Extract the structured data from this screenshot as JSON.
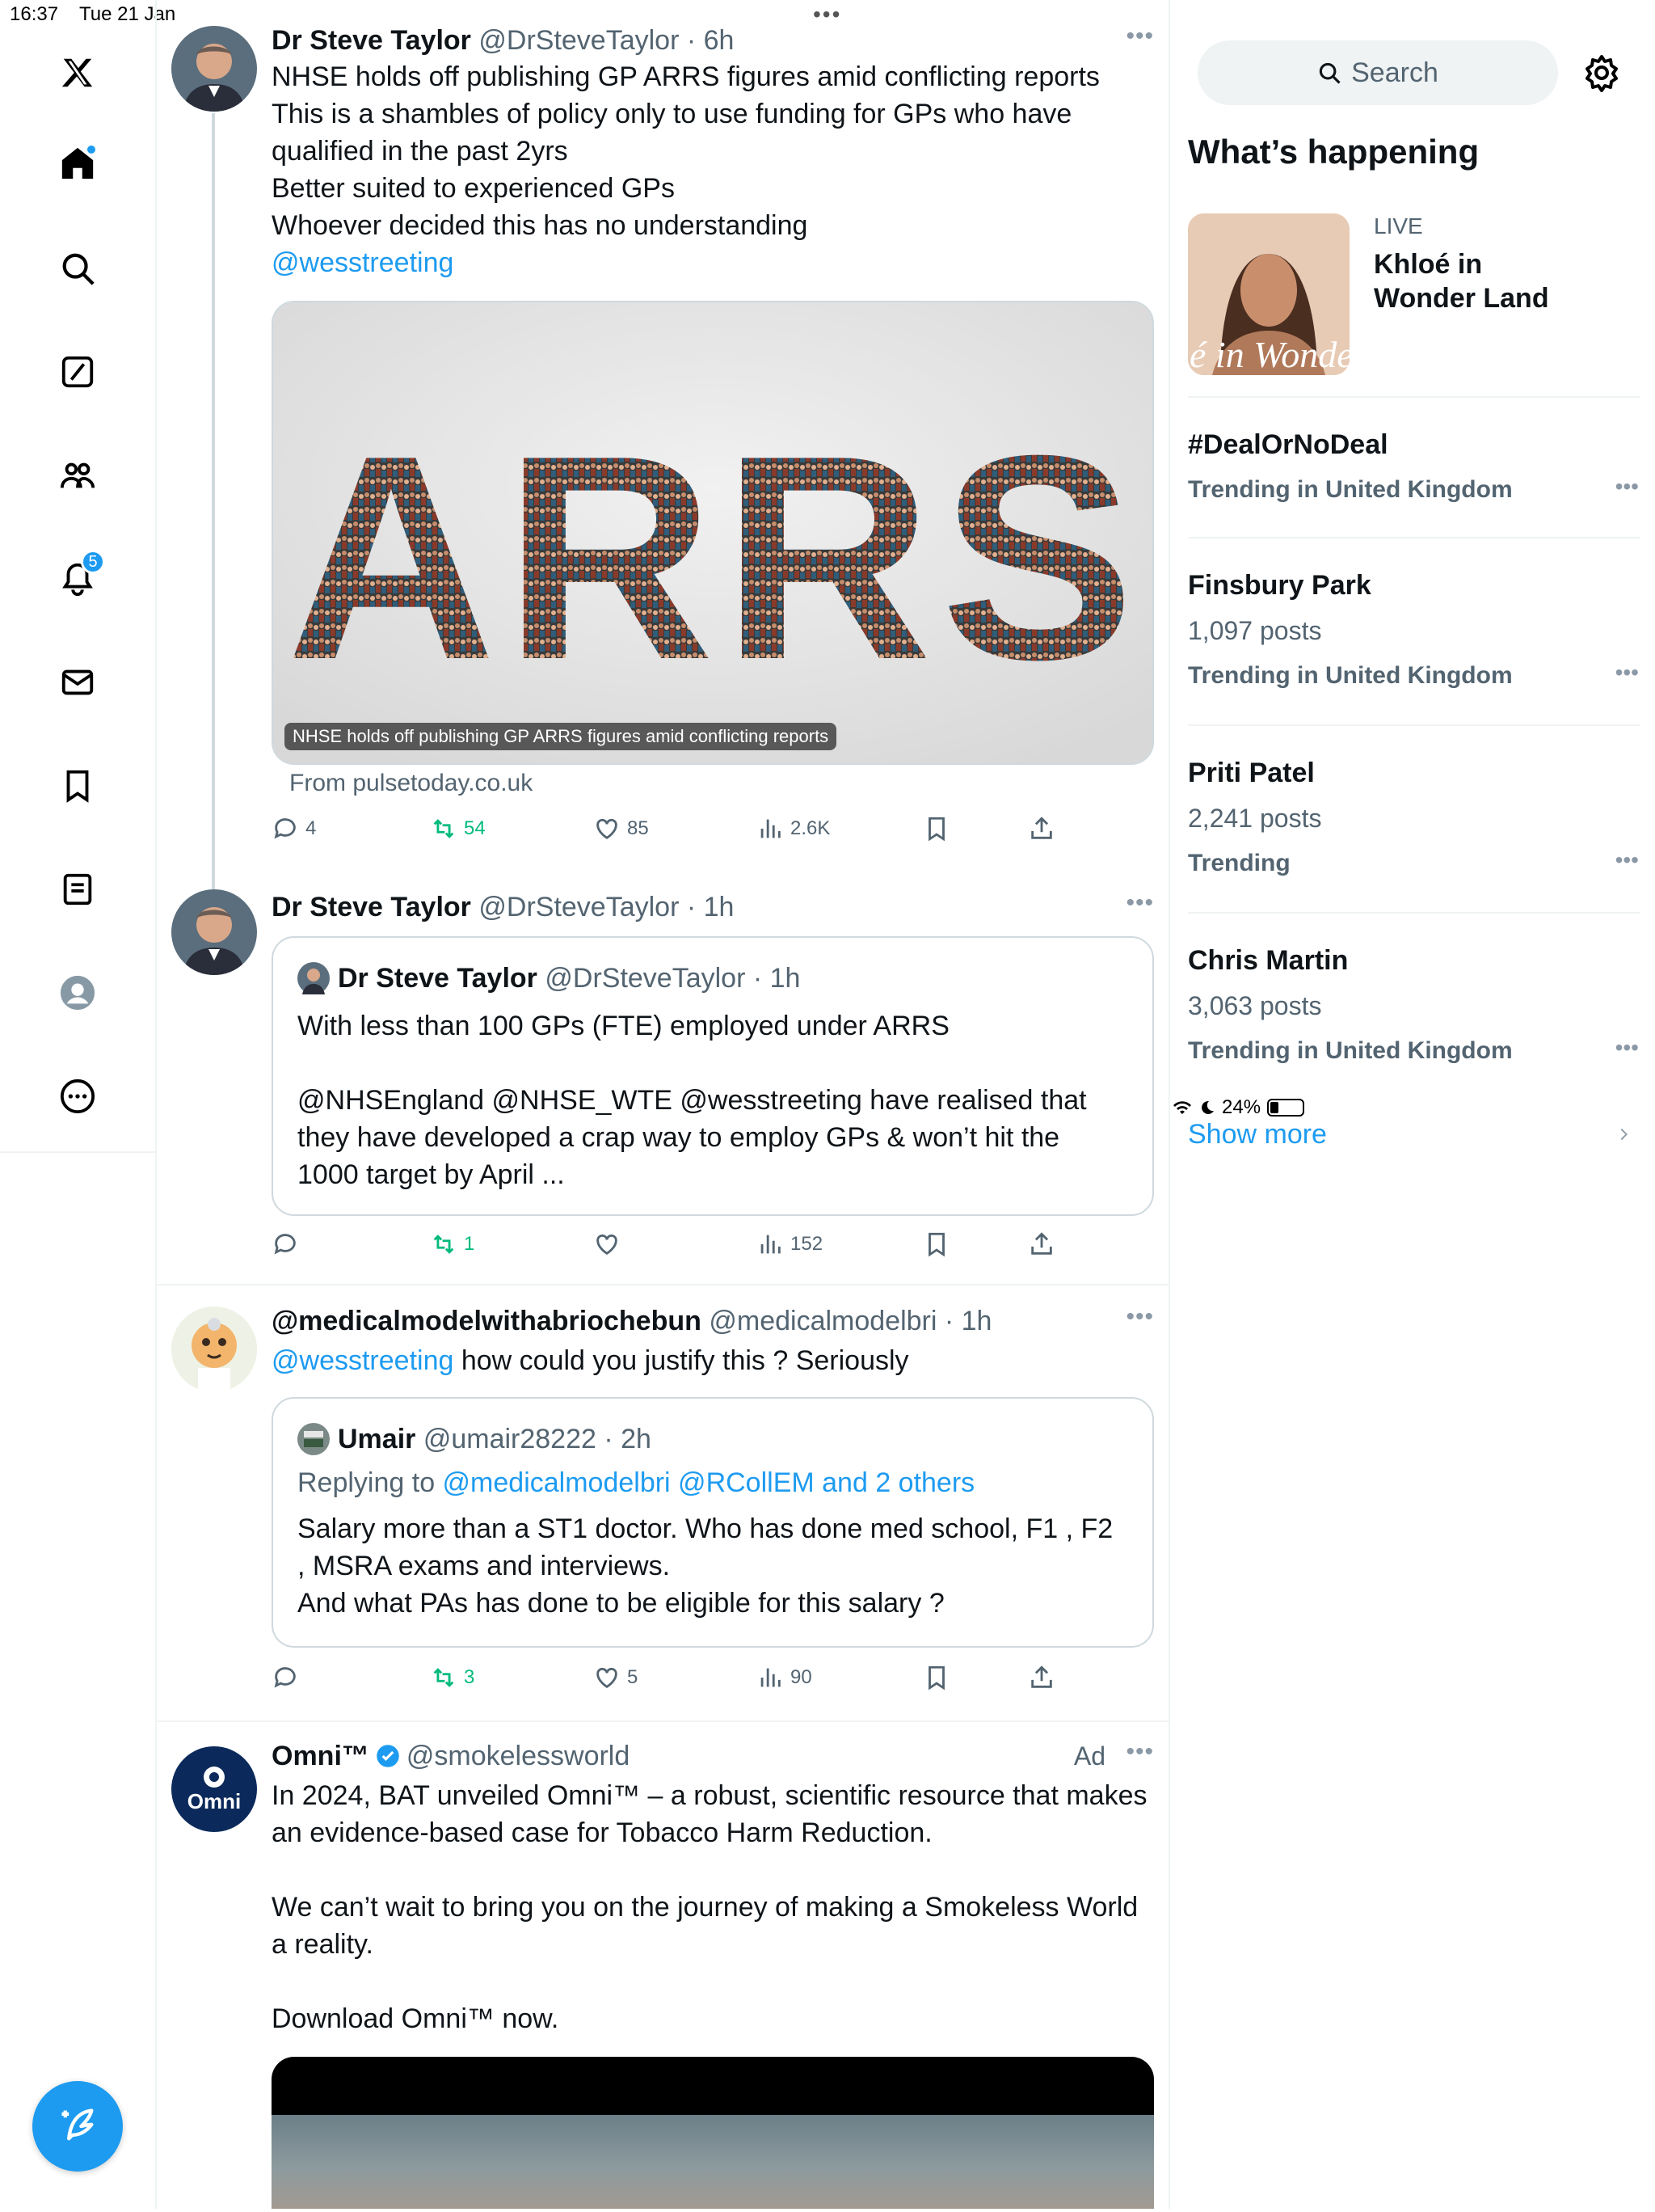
{
  "status": {
    "time": "16:37",
    "date": "Tue 21 Jan",
    "battery": "24%"
  },
  "nav": {
    "notif_count": "5"
  },
  "tweets": [
    {
      "name": "Dr Steve Taylor",
      "meta": "@DrSteveTaylor · 6h",
      "lines": [
        "NHSE holds off publishing GP ARRS figures amid conflicting reports",
        "This is a shambles of policy only to use funding for GPs who have qualified in the past 2yrs",
        "Better suited to experienced GPs",
        "Whoever decided this has no understanding"
      ],
      "mention": "@wesstreeting",
      "card_caption": "NHSE holds off publishing GP ARRS figures amid conflicting reports",
      "card_source": "From pulsetoday.co.uk",
      "card_image_text": "ARRS",
      "replies": "4",
      "retweets": "54",
      "likes": "85",
      "views": "2.6K"
    },
    {
      "name": "Dr Steve Taylor",
      "meta": "@DrSteveTaylor · 1h",
      "quote": {
        "name": "Dr Steve Taylor",
        "meta": "@DrSteveTaylor · 1h",
        "text1": "With less than 100 GPs (FTE) employed under ARRS",
        "text2": "@NHSEngland @NHSE_WTE @wesstreeting have realised that they have developed a crap way to employ GPs & won’t hit the 1000 target by April ..."
      },
      "retweets": "1",
      "views": "152"
    },
    {
      "name": "@medicalmodelwithabriochebun",
      "meta": "@medicalmodelbri · 1h",
      "mention": "@wesstreeting",
      "text": " how could you justify this ? Seriously",
      "quote": {
        "name": "Umair",
        "meta": "@umair28222 · 2h",
        "replying_prefix": "Replying to ",
        "replying_to": "@medicalmodelbri @RCollEM and 2 others",
        "text": "Salary more than a ST1 doctor. Who has done med school, F1 , F2 , MSRA exams and interviews.",
        "text2": "And what PAs has done to be eligible for this salary ?"
      },
      "retweets": "3",
      "likes": "5",
      "views": "90"
    },
    {
      "name": "Omni™",
      "meta": "@smokelessworld",
      "ad": "Ad",
      "avatar_text": "Omni",
      "p1": "In 2024, BAT unveiled Omni™ – a robust, scientific resource that makes an evidence-based case for Tobacco Harm Reduction.",
      "p2": "We can’t wait to bring you on the journey of making a Smokeless World a reality.",
      "p3": "Download Omni™ now."
    }
  ],
  "sidebar": {
    "search_placeholder": "Search",
    "heading": "What’s happening",
    "live": {
      "tag": "LIVE",
      "title": "Khloé in Wonder Land",
      "image_text": "é in Wonder l"
    },
    "trends": [
      {
        "title": "#DealOrNoDeal",
        "posts": "",
        "context": "Trending in United Kingdom"
      },
      {
        "title": "Finsbury Park",
        "posts": "1,097 posts",
        "context": "Trending in United Kingdom"
      },
      {
        "title": "Priti Patel",
        "posts": "2,241 posts",
        "context": "Trending"
      },
      {
        "title": "Chris Martin",
        "posts": "3,063 posts",
        "context": "Trending in United Kingdom"
      }
    ],
    "show_more": "Show more"
  },
  "colors": {
    "accent": "#1d9bf0",
    "retweet": "#00ba7c"
  }
}
